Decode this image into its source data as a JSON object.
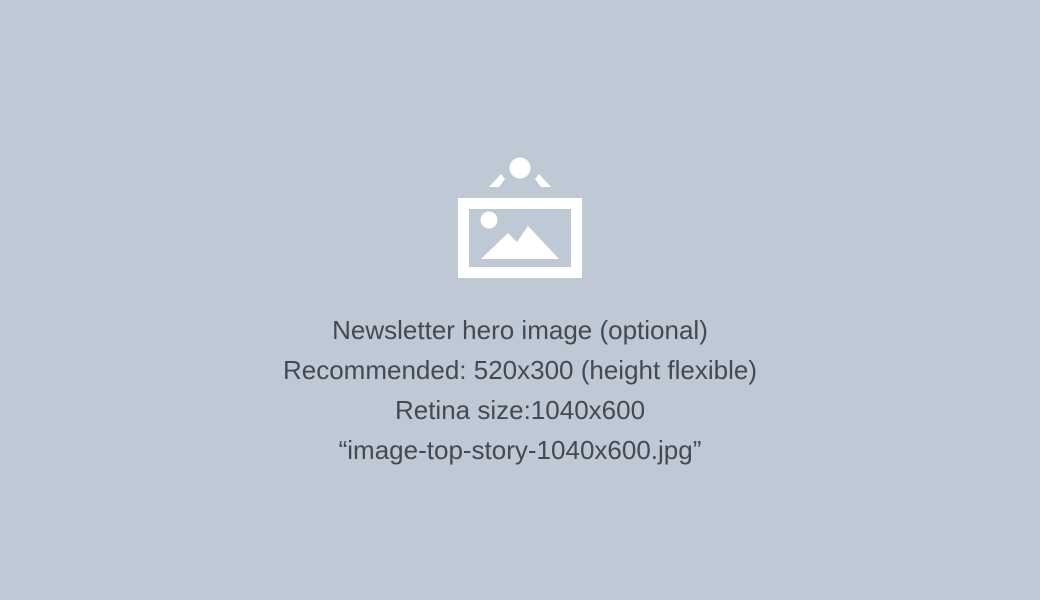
{
  "colors": {
    "background": "#bfc8d5",
    "icon": "#ffffff",
    "text": "#454a52"
  },
  "icon": "hanging-picture-icon",
  "caption": {
    "title": "Newsletter hero image (optional)",
    "recommended": "Recommended: 520x300 (height flexible)",
    "retina": "Retina size:1040x600",
    "filename": "“image-top-story-1040x600.jpg”"
  }
}
